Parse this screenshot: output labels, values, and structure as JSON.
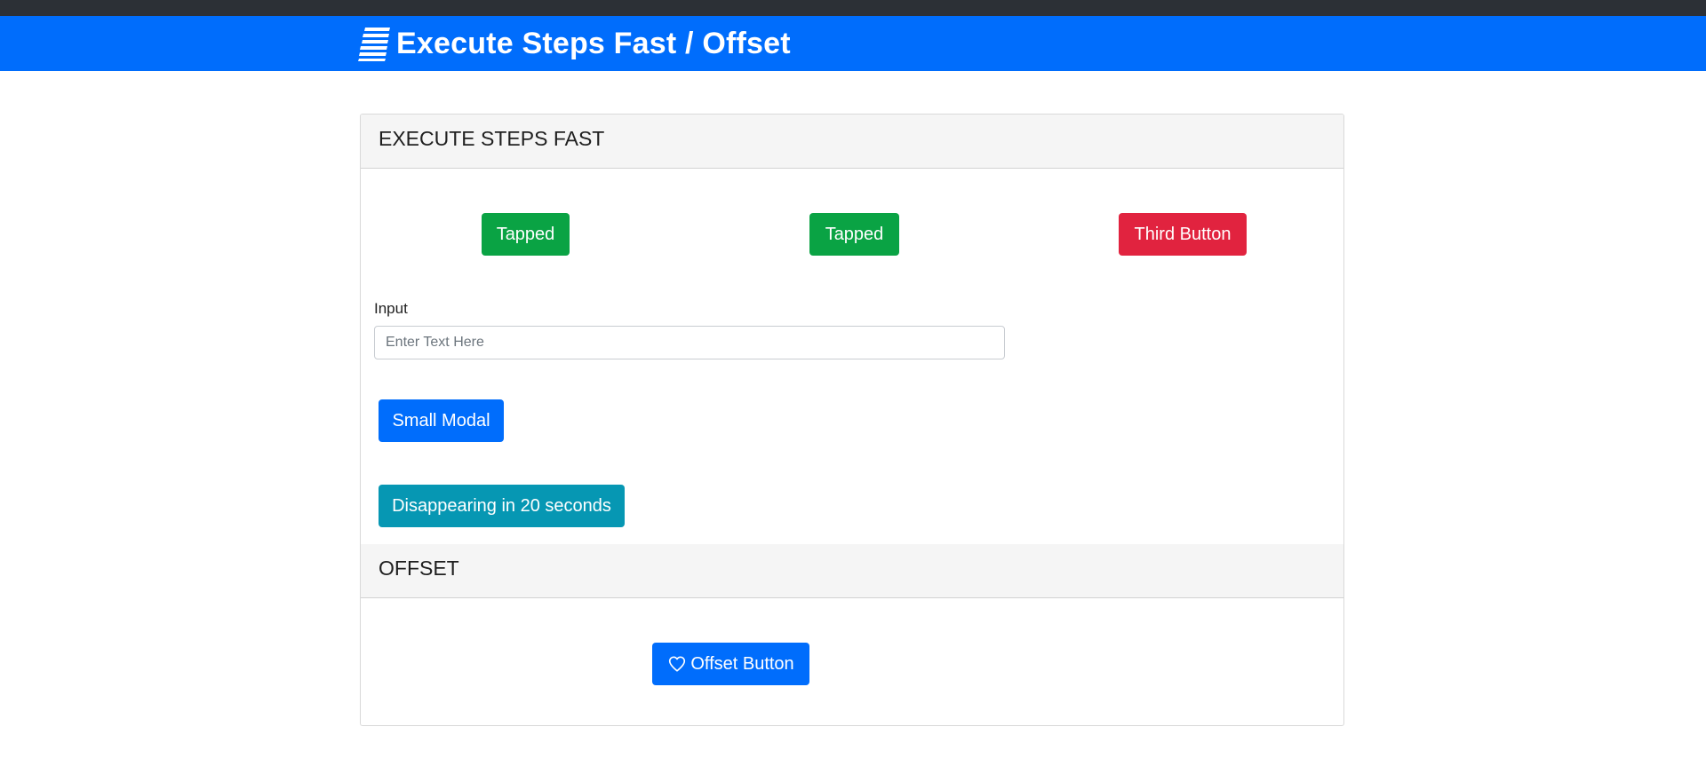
{
  "header": {
    "title": "Execute Steps Fast / Offset",
    "logo_icon": "stacked-lines-logo-icon"
  },
  "colors": {
    "navbar": "#006dfc",
    "top_strip": "#2c3036",
    "tapped_button": "#0aa344",
    "third_button": "#e1233f",
    "primary_button": "#006dfc",
    "info_button": "#0697b3"
  },
  "execute_section": {
    "title": "EXECUTE STEPS FAST",
    "buttons": {
      "first": "Tapped",
      "second": "Tapped",
      "third": "Third Button"
    },
    "input": {
      "label": "Input",
      "placeholder": "Enter Text Here",
      "value": ""
    },
    "small_modal_label": "Small Modal",
    "disappearing_label": "Disappearing in 20 seconds"
  },
  "offset_section": {
    "title": "OFFSET",
    "offset_button_label": "Offset Button",
    "offset_button_icon": "heart-icon"
  }
}
